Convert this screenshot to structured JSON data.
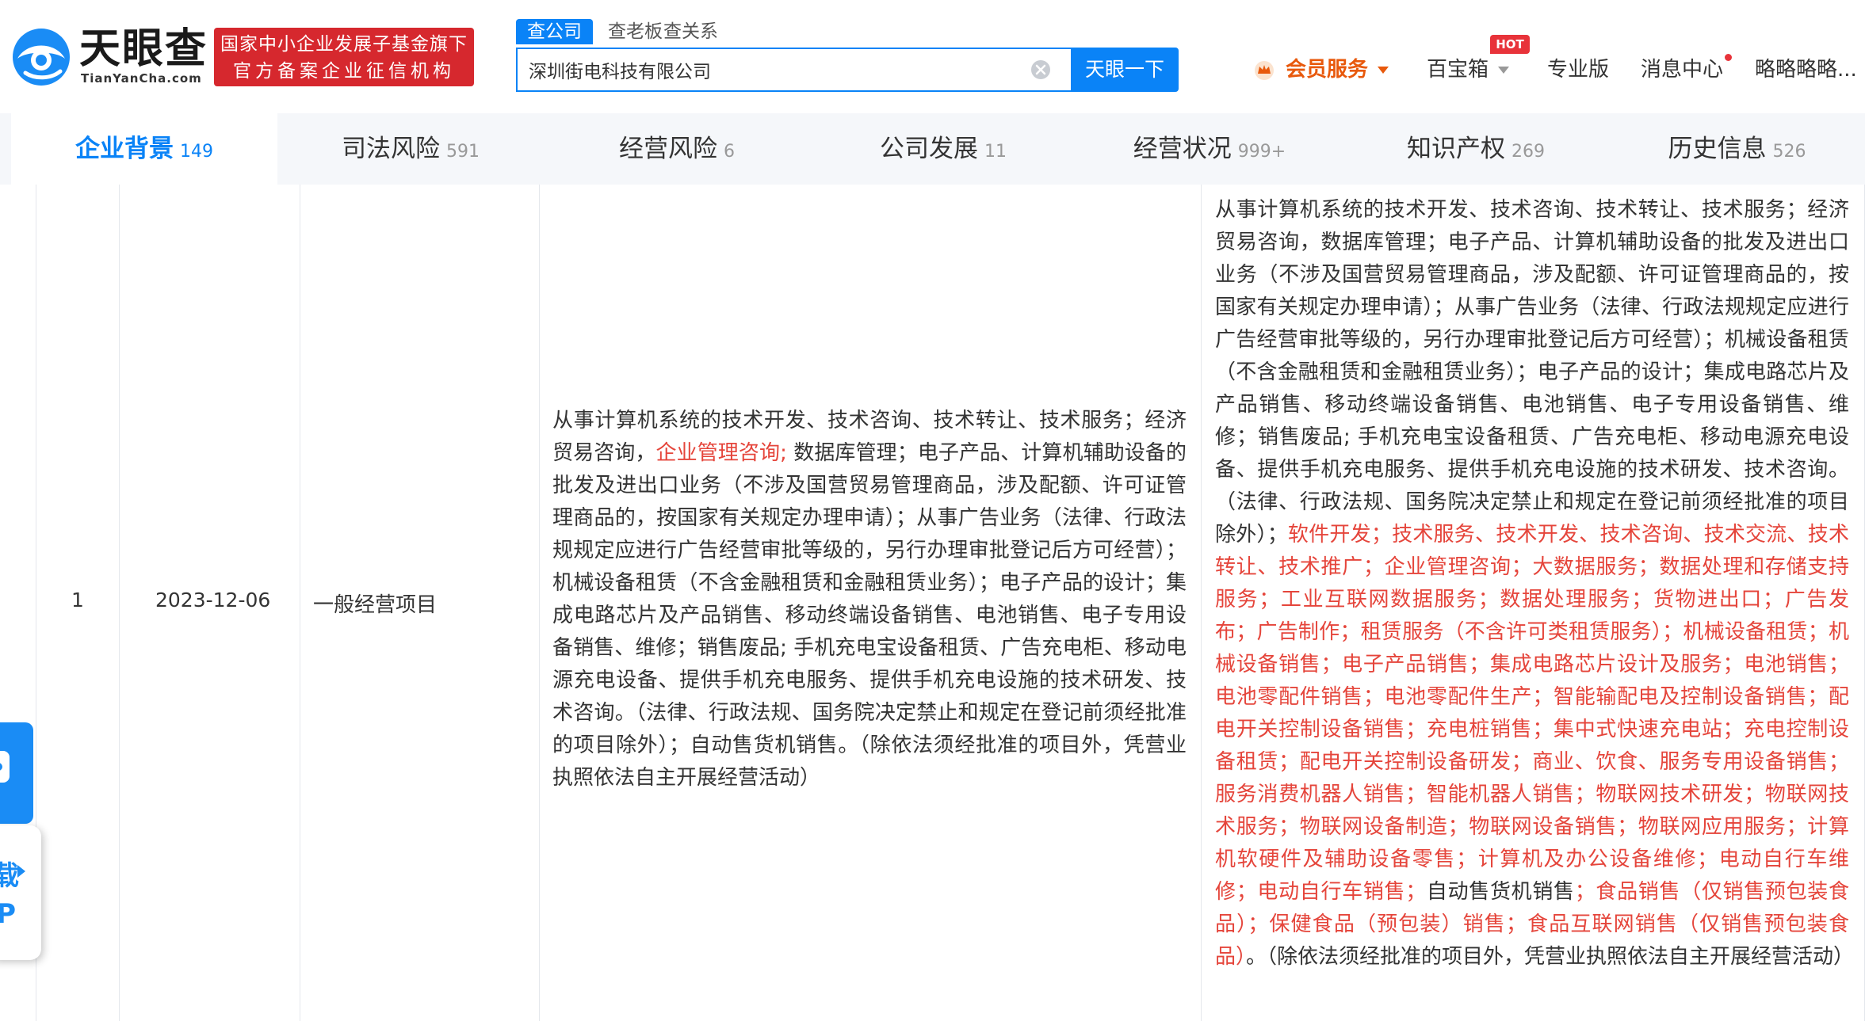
{
  "brand": {
    "name": "天眼查",
    "domain": "TianYanCha.com",
    "badge_line1": "国家中小企业发展子基金旗下",
    "badge_line2": "官方备案企业征信机构"
  },
  "search": {
    "tabs": [
      "查公司",
      "查老板",
      "查关系"
    ],
    "value": "深圳街电科技有限公司",
    "button": "天眼一下"
  },
  "topnav": {
    "vip": "会员服务",
    "baibaoxiang": "百宝箱",
    "hot": "HOT",
    "pro": "专业版",
    "messages": "消息中心",
    "user": "略略略略..."
  },
  "categories": [
    {
      "label": "企业背景",
      "count": "149"
    },
    {
      "label": "司法风险",
      "count": "591"
    },
    {
      "label": "经营风险",
      "count": "6"
    },
    {
      "label": "公司发展",
      "count": "11"
    },
    {
      "label": "经营状况",
      "count": "999+"
    },
    {
      "label": "知识产权",
      "count": "269"
    },
    {
      "label": "历史信息",
      "count": "526"
    }
  ],
  "row": {
    "index": "1",
    "date": "2023-12-06",
    "item": "一般经营项目",
    "before": [
      {
        "t": "从事计算机系统的技术开发、技术咨询、技术转让、技术服务；经济贸易咨询，",
        "hl": false
      },
      {
        "t": "企业管理咨询;",
        "hl": true
      },
      {
        "t": " 数据库管理；电子产品、计算机辅助设备的批发及进出口业务（不涉及国营贸易管理商品，涉及配额、许可证管理商品的，按国家有关规定办理申请）；从事广告业务（法律、行政法规规定应进行广告经营审批等级的，另行办理审批登记后方可经营）；机械设备租赁（不含金融租赁和金融租赁业务）；电子产品的设计；集成电路芯片及产品销售、移动终端设备销售、电池销售、电子专用设备销售、维修；销售废品; 手机充电宝设备租赁、广告充电柜、移动电源充电设备、提供手机充电服务、提供手机充电设施的技术研发、技术咨询。（法律、行政法规、国务院决定禁止和规定在登记前须经批准的项目除外）；自动售货机销售。（除依法须经批准的项目外，凭营业执照依法自主开展经营活动）",
        "hl": false
      }
    ],
    "after": [
      {
        "t": "从事计算机系统的技术开发、技术咨询、技术转让、技术服务；经济贸易咨询，数据库管理；电子产品、计算机辅助设备的批发及进出口业务（不涉及国营贸易管理商品，涉及配额、许可证管理商品的，按国家有关规定办理申请）；从事广告业务（法律、行政法规规定应进行广告经营审批等级的，另行办理审批登记后方可经营）；机械设备租赁（不含金融租赁和金融租赁业务）；电子产品的设计；集成电路芯片及产品销售、移动终端设备销售、电池销售、电子专用设备销售、维修；销售废品; 手机充电宝设备租赁、广告充电柜、移动电源充电设备、提供手机充电服务、提供手机充电设施的技术研发、技术咨询。（法律、行政法规、国务院决定禁止和规定在登记前须经批准的项目除外）；",
        "hl": false
      },
      {
        "t": "软件开发；技术服务、技术开发、技术咨询、技术交流、技术转让、技术推广；企业管理咨询；大数据服务；数据处理和存储支持服务；工业互联网数据服务；数据处理服务；货物进出口；广告发布；广告制作；租赁服务（不含许可类租赁服务）；机械设备租赁；机械设备销售；电子产品销售；集成电路芯片设计及服务；电池销售；电池零配件销售；电池零配件生产；智能输配电及控制设备销售；配电开关控制设备销售；充电桩销售；集中式快速充电站；充电控制设备租赁；配电开关控制设备研发；商业、饮食、服务专用设备销售；服务消费机器人销售；智能机器人销售；物联网技术研发；物联网技术服务；物联网设备制造；物联网设备销售；物联网应用服务；计算机软硬件及辅助设备零售；计算机及办公设备维修；电动自行车维修；电动自行车销售；",
        "hl": true
      },
      {
        "t": "自动售货机销售",
        "hl": false
      },
      {
        "t": "；食品销售（仅销售预包装食品）；保健食品（预包装）销售；食品互联网销售（仅销售预包装食品）",
        "hl": true
      },
      {
        "t": "。（除依法须经批准的项目外，凭营业执照依法自主开展经营活动）",
        "hl": false
      }
    ]
  },
  "side_widgets": {
    "app_text_1": "载",
    "app_text_2": "P"
  },
  "colors": {
    "primary": "#0a83f7",
    "brand_red": "#d6282e",
    "highlight": "#e5453b",
    "vip": "#e8590c"
  }
}
